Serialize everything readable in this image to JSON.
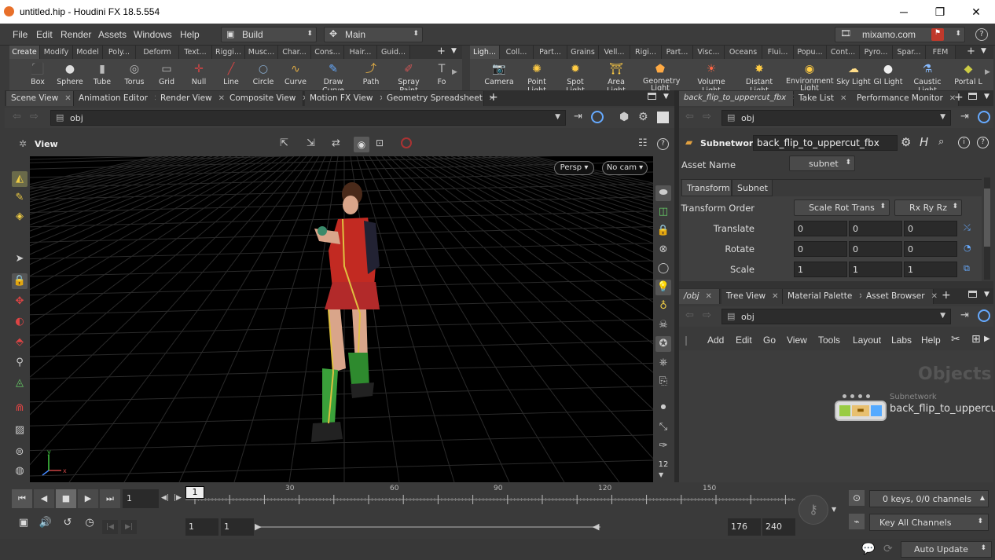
{
  "window": {
    "title": "untitled.hip - Houdini FX 18.5.554"
  },
  "menu": {
    "items": [
      "File",
      "Edit",
      "Render",
      "Assets",
      "Windows",
      "Help"
    ],
    "desktop": "Build",
    "context": "Main",
    "user": "mixamo.com"
  },
  "shelf_left": {
    "tabs": [
      "Create",
      "Modify",
      "Model",
      "Poly...",
      "Deform",
      "Text...",
      "Riggi...",
      "Musc...",
      "Char...",
      "Cons...",
      "Hair...",
      "Guid..."
    ],
    "tools": [
      {
        "label": "Box",
        "icon": "box-icon"
      },
      {
        "label": "Sphere",
        "icon": "sphere-icon"
      },
      {
        "label": "Tube",
        "icon": "tube-icon"
      },
      {
        "label": "Torus",
        "icon": "torus-icon"
      },
      {
        "label": "Grid",
        "icon": "grid-icon"
      },
      {
        "label": "Null",
        "icon": "null-icon"
      },
      {
        "label": "Line",
        "icon": "line-icon"
      },
      {
        "label": "Circle",
        "icon": "circle-icon"
      },
      {
        "label": "Curve",
        "icon": "curve-icon"
      },
      {
        "label": "Draw Curve",
        "icon": "draw-curve-icon"
      },
      {
        "label": "Path",
        "icon": "path-icon"
      },
      {
        "label": "Spray Paint",
        "icon": "spray-paint-icon"
      },
      {
        "label": "Fo",
        "icon": "font-icon"
      }
    ]
  },
  "shelf_right": {
    "tabs": [
      "Ligh...",
      "Coll...",
      "Part...",
      "Grains",
      "Vell...",
      "Rigi...",
      "Part...",
      "Visc...",
      "Oceans",
      "Flui...",
      "Popu...",
      "Cont...",
      "Pyro...",
      "Spar...",
      "FEM"
    ],
    "tools": [
      {
        "label": "Camera",
        "icon": "camera-icon"
      },
      {
        "label": "Point Light",
        "icon": "point-light-icon"
      },
      {
        "label": "Spot Light",
        "icon": "spot-light-icon"
      },
      {
        "label": "Area Light",
        "icon": "area-light-icon"
      },
      {
        "label": "Geometry Light",
        "icon": "geometry-light-icon"
      },
      {
        "label": "Volume Light",
        "icon": "volume-light-icon"
      },
      {
        "label": "Distant Light",
        "icon": "distant-light-icon"
      },
      {
        "label": "Environment Light",
        "icon": "environment-light-icon"
      },
      {
        "label": "Sky Light",
        "icon": "sky-light-icon"
      },
      {
        "label": "GI Light",
        "icon": "gi-light-icon"
      },
      {
        "label": "Caustic Light",
        "icon": "caustic-light-icon"
      },
      {
        "label": "Portal L",
        "icon": "portal-light-icon"
      }
    ]
  },
  "left_panel": {
    "tabs": [
      "Scene View",
      "Animation Editor",
      "Render View",
      "Composite View",
      "Motion FX View",
      "Geometry Spreadsheet"
    ],
    "path": "obj",
    "view_label": "View",
    "persp": "Persp ▾",
    "cam": "No cam ▾",
    "right_toolbar_number": "12"
  },
  "param_panel": {
    "tabs": [
      "back_flip_to_uppercut_fbx",
      "Take List",
      "Performance Monitor"
    ],
    "path": "obj",
    "node_type": "Subnetwork",
    "node_name": "back_flip_to_uppercut_fbx",
    "asset_name_label": "Asset Name",
    "asset_name_value": "subnet",
    "sub_tabs": [
      "Transform",
      "Subnet"
    ],
    "transform_order_label": "Transform Order",
    "transform_order_value": "Scale Rot Trans",
    "rot_order_value": "Rx Ry Rz",
    "rows": [
      {
        "label": "Translate",
        "values": [
          "0",
          "0",
          "0"
        ]
      },
      {
        "label": "Rotate",
        "values": [
          "0",
          "0",
          "0"
        ]
      },
      {
        "label": "Scale",
        "values": [
          "1",
          "1",
          "1"
        ]
      }
    ]
  },
  "network_panel": {
    "tabs": [
      "/obj",
      "Tree View",
      "Material Palette",
      "Asset Browser"
    ],
    "path": "obj",
    "menu": [
      "Add",
      "Edit",
      "Go",
      "View",
      "Tools",
      "Layout",
      "Labs",
      "Help"
    ],
    "watermark": "Objects",
    "node_type": "Subnetwork",
    "node_name": "back_flip_to_uppercu"
  },
  "timeline": {
    "frame": "1",
    "marker": "1",
    "ticks": [
      "30",
      "60",
      "90",
      "120",
      "150"
    ],
    "range_start": "1",
    "range_start2": "1",
    "range_end": "176",
    "range_end2": "240",
    "keys_label": "0 keys, 0/0 channels",
    "key_all": "Key All Channels"
  },
  "status": {
    "update_mode": "Auto Update"
  }
}
